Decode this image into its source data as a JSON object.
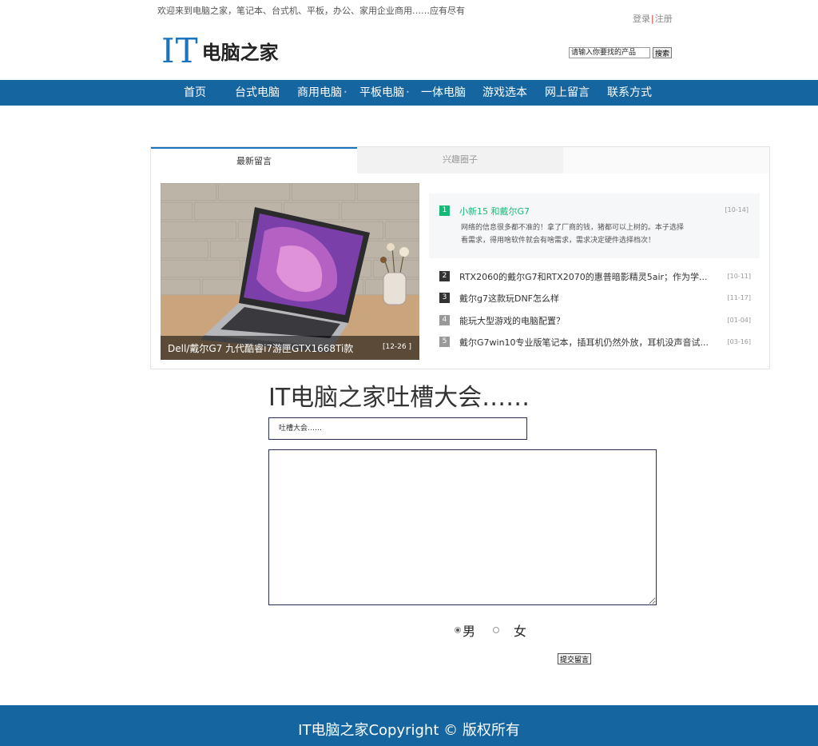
{
  "header": {
    "welcome": "欢迎来到电脑之家，笔记本、台式机、平板，办公、家用企业商用……应有尽有",
    "login": "登录",
    "register": "注册",
    "logo_it": "IT",
    "logo_name": "电脑之家",
    "search_placeholder": "请输入你要找的产品",
    "search_button": "搜索"
  },
  "nav": {
    "items": [
      "首页",
      "台式电脑",
      "商用电脑",
      "平板电脑",
      "一体电脑",
      "游戏选本",
      "网上留言",
      "联系方式"
    ],
    "dot": "•"
  },
  "panel": {
    "tabs": [
      "最新留言",
      "兴趣圈子"
    ],
    "photo_caption": "Dell/戴尔G7 九代酷睿i7游匣GTX1668Ti款",
    "photo_date": "[12-26 ]",
    "feature": {
      "rank": "1",
      "title": "小新15 和戴尔G7",
      "date": "[10-14]",
      "desc": "网络的信息很多都不准的！拿了厂商的钱，猪都可以上树的。本子选择看需求，得用啥软件就会有啥需求，需求决定硬件选择档次！"
    },
    "list": [
      {
        "rank": "2",
        "title": "RTX2060的戴尔G7和RTX2070的惠普暗影精灵5air；作为学...",
        "date": "[10-11]"
      },
      {
        "rank": "3",
        "title": "戴尔g7这款玩DNF怎么样",
        "date": "[11-17]"
      },
      {
        "rank": "4",
        "title": "能玩大型游戏的电脑配置？",
        "date": "[01-04]"
      },
      {
        "rank": "5",
        "title": "戴尔G7win10专业版笔记本，插耳机仍然外放，耳机没声音试...",
        "date": "[03-16]"
      }
    ]
  },
  "form": {
    "heading": "IT电脑之家吐槽大会……",
    "subject_placeholder": "吐槽大会……",
    "message_value": "",
    "male": "男",
    "female": "女",
    "submit": "提交留言"
  },
  "footer": {
    "text": "IT电脑之家Copyright © 版权所有"
  },
  "colors": {
    "brand_blue": "#1565a0",
    "accent_green": "#17b978",
    "logo_blue": "#1e73be"
  }
}
